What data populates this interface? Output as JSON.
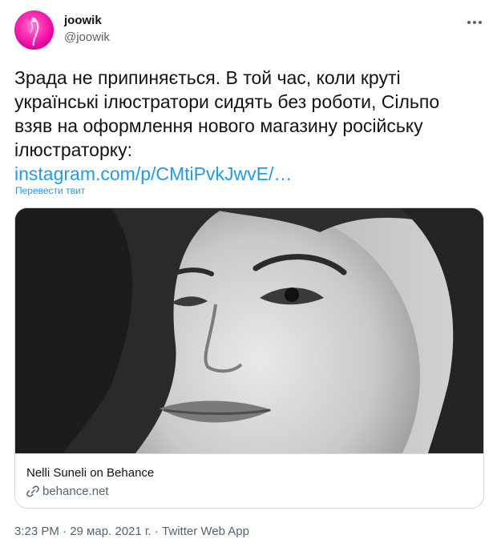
{
  "user": {
    "display_name": "joowik",
    "handle": "@joowik"
  },
  "tweet": {
    "lines": [
      "Зрада не припиняється. В той час, коли круті",
      "українські ілюстратори сидять без роботи, Сільпо",
      "взяв на оформлення нового магазину російську",
      "ілюстраторку:"
    ],
    "link_text": "instagram.com/p/CMtiPvkJwvE/…",
    "translate_label": "Перевести твит"
  },
  "card": {
    "title": "Nelli Suneli on Behance",
    "domain": "behance.net",
    "domain_icon": "link-icon"
  },
  "meta": {
    "text": "3:23 PM · 29 мар. 2021 г. · Twitter Web App"
  },
  "colors": {
    "accent": "#1d9bf0",
    "secondary_text": "#536471",
    "border": "#cfd9de",
    "avatar": "#ff2fb4"
  }
}
